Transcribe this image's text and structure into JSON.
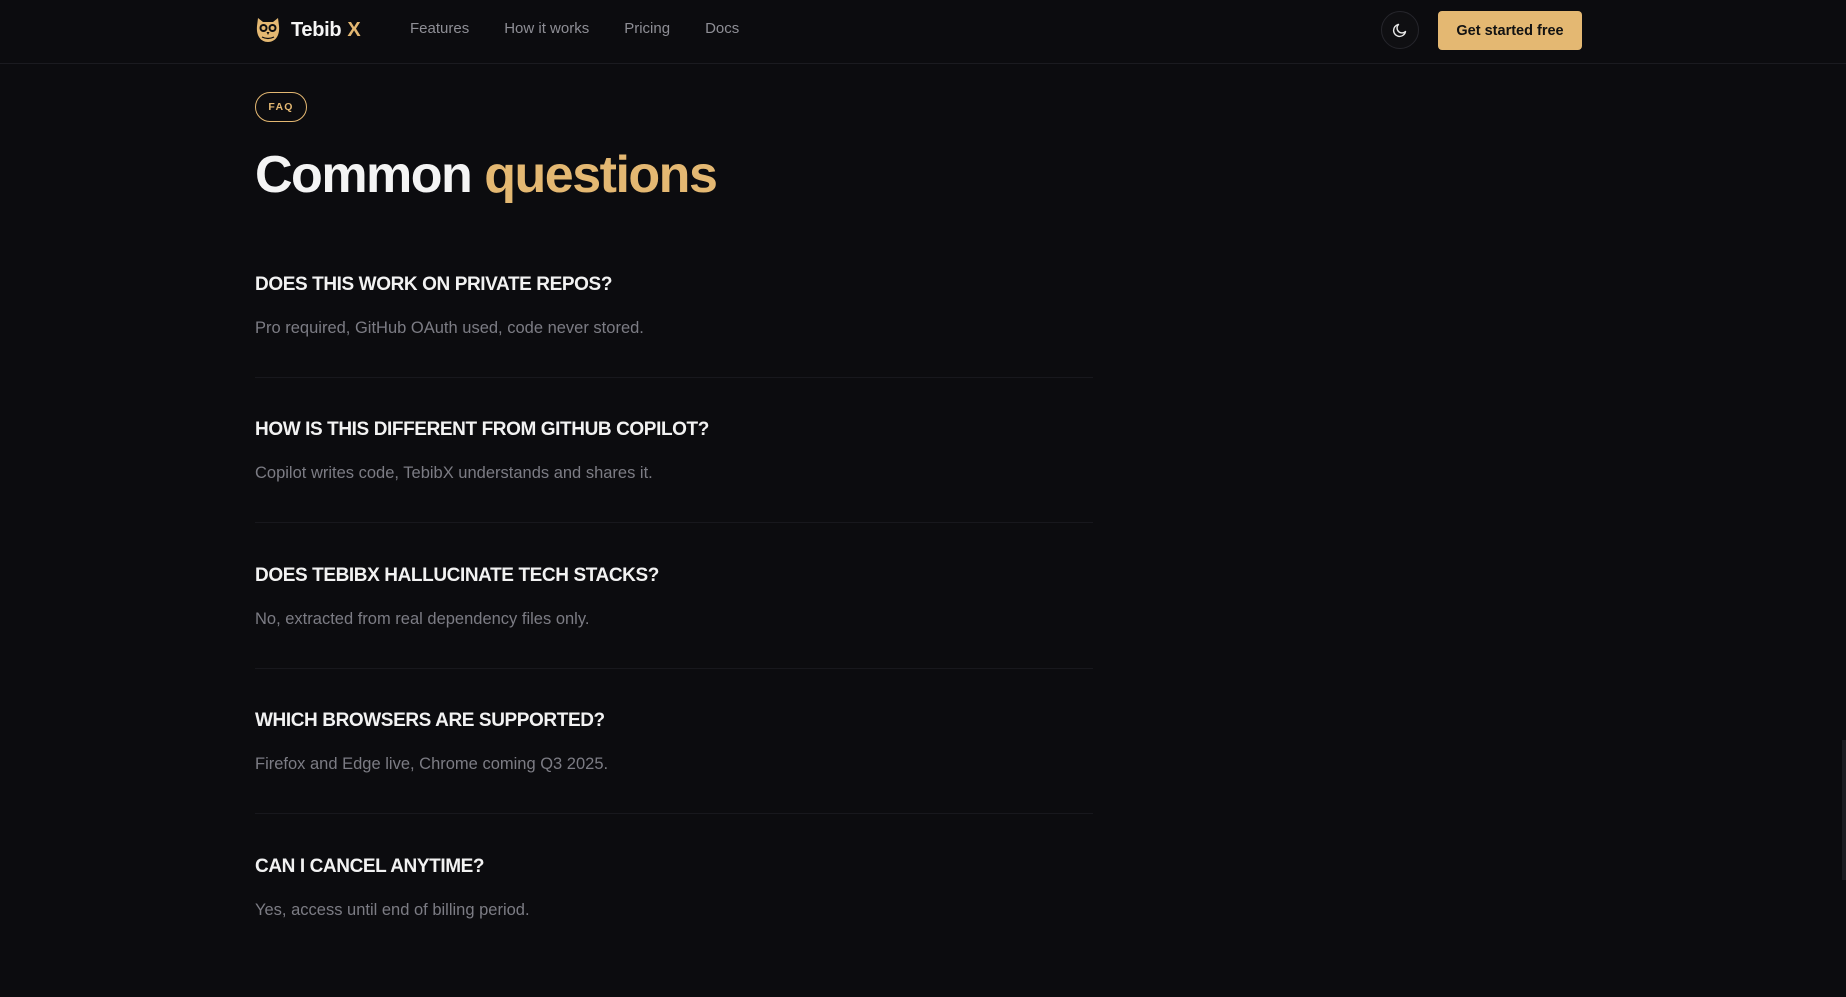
{
  "nav": {
    "brand_name": "Tebib",
    "brand_suffix": "X",
    "logo_icon": "owl-icon",
    "links": [
      "Features",
      "How it works",
      "Pricing",
      "Docs"
    ],
    "theme_icon": "moon-icon",
    "cta_label": "Get started free"
  },
  "section": {
    "badge": "FAQ",
    "title_white": "Common",
    "title_gold": "questions"
  },
  "faqs": [
    {
      "question": "DOES THIS WORK ON PRIVATE REPOS?",
      "answer": "Pro required, GitHub OAuth used, code never stored."
    },
    {
      "question": "HOW IS THIS DIFFERENT FROM GITHUB COPILOT?",
      "answer": "Copilot writes code, TebibX understands and shares it."
    },
    {
      "question": "DOES TEBIBX HALLUCINATE TECH STACKS?",
      "answer": "No, extracted from real dependency files only."
    },
    {
      "question": "WHICH BROWSERS ARE SUPPORTED?",
      "answer": "Firefox and Edge live, Chrome coming Q3 2025."
    },
    {
      "question": "CAN I CANCEL ANYTIME?",
      "answer": "Yes, access until end of billing period."
    }
  ],
  "colors": {
    "background": "#0c0c0f",
    "accent": "#e4b872",
    "muted_text": "#7c7c84"
  }
}
